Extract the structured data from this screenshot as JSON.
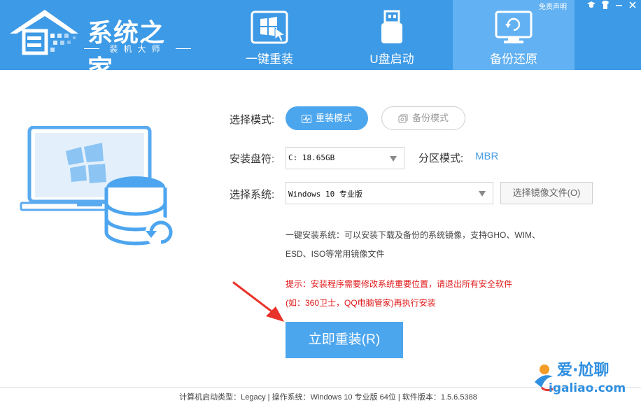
{
  "brand": {
    "title": "系统之家",
    "subtitle": "装机大师"
  },
  "top_bar": {
    "disclaimer": "免责声明",
    "icons": [
      "graduation-cap-icon",
      "shirt-icon",
      "minimize-icon",
      "close-icon"
    ]
  },
  "nav": {
    "tabs": [
      {
        "label": "一键重装",
        "icon": "windows-cursor-icon",
        "active": false
      },
      {
        "label": "U盘启动",
        "icon": "usb-drive-icon",
        "active": false
      },
      {
        "label": "备份还原",
        "icon": "monitor-restore-icon",
        "active": true
      }
    ]
  },
  "form": {
    "mode_label": "选择模式:",
    "mode_options": [
      {
        "label": "重装模式",
        "icon": "pulse-icon",
        "selected": true
      },
      {
        "label": "备份模式",
        "icon": "backup-icon",
        "selected": false
      }
    ],
    "disk_label": "安装盘符:",
    "disk_value": "C: 18.65GB",
    "partition_label": "分区模式:",
    "partition_value": "MBR",
    "system_label": "选择系统:",
    "system_value": "Windows 10 专业版",
    "browse_label": "选择镜像文件(O)"
  },
  "info": {
    "line1": "一键安装系统：可以安装下载及备份的系统镜像，支持GHO、WIM、",
    "line2": "ESD、ISO等常用镜像文件",
    "warn1": "提示：安装程序需要修改系统重要位置，请退出所有安全软件",
    "warn2": "(如：360卫士，QQ电脑管家)再执行安装"
  },
  "install_button": "立即重装(R)",
  "footer": "计算机启动类型：Legacy | 操作系统：Windows 10 专业版 64位 | 软件版本：1.5.6.5388",
  "watermark": {
    "text1": "爱·尬聊",
    "text2": "igaliao.com"
  },
  "colors": {
    "header": "#3d9ae6",
    "active_tab": "#62b1f2",
    "primary": "#4ca6ee",
    "warning": "#e01818",
    "arrow": "#e8332a"
  }
}
